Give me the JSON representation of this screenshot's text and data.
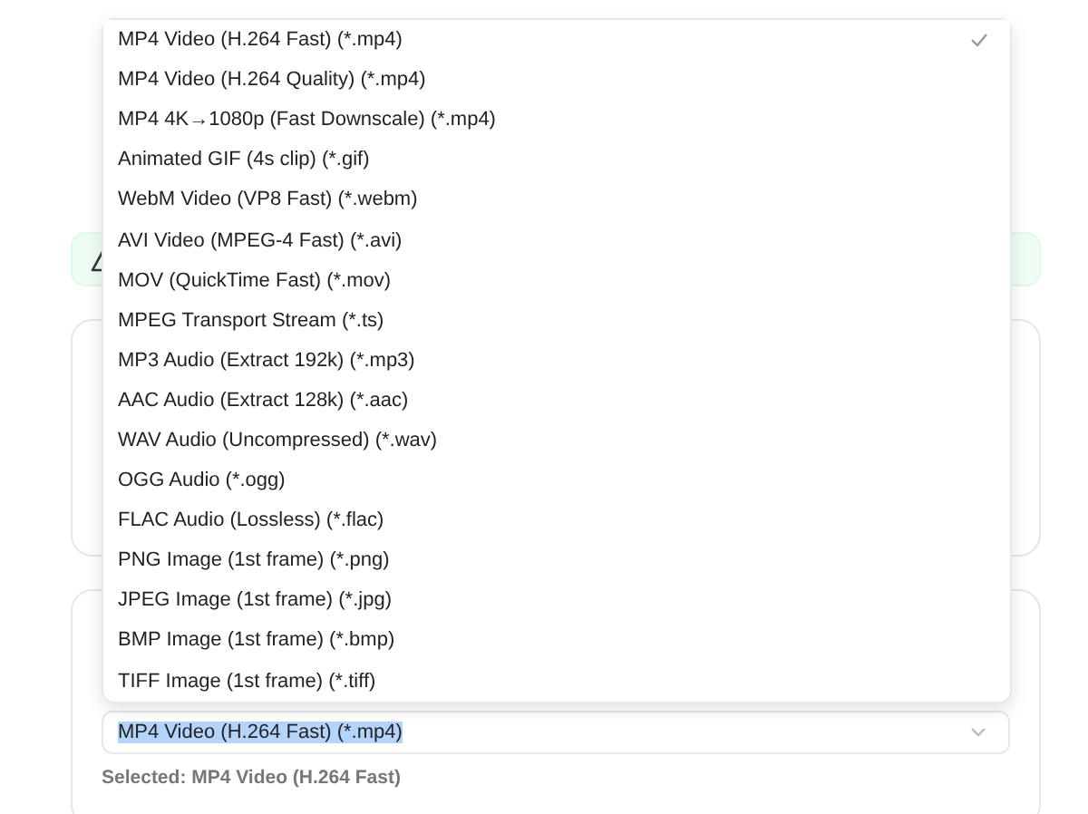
{
  "format_menu": {
    "options": [
      {
        "label": "MP4 Video (H.264 Fast) (*.mp4)",
        "selected": true
      },
      {
        "label": "MP4 Video (H.264 Quality) (*.mp4)",
        "selected": false
      },
      {
        "label": "MP4 4K→1080p (Fast Downscale) (*.mp4)",
        "selected": false
      },
      {
        "label": "Animated GIF (4s clip) (*.gif)",
        "selected": false
      },
      {
        "label": "WebM Video (VP8 Fast) (*.webm)",
        "selected": false
      },
      {
        "label": "AVI Video (MPEG-4 Fast) (*.avi)",
        "selected": false
      },
      {
        "label": "MOV (QuickTime Fast) (*.mov)",
        "selected": false
      },
      {
        "label": "MPEG Transport Stream (*.ts)",
        "selected": false
      },
      {
        "label": "MP3 Audio (Extract 192k) (*.mp3)",
        "selected": false
      },
      {
        "label": "AAC Audio (Extract 128k) (*.aac)",
        "selected": false
      },
      {
        "label": "WAV Audio (Uncompressed) (*.wav)",
        "selected": false
      },
      {
        "label": "OGG Audio (*.ogg)",
        "selected": false
      },
      {
        "label": "FLAC Audio (Lossless) (*.flac)",
        "selected": false
      },
      {
        "label": "PNG Image (1st frame) (*.png)",
        "selected": false
      },
      {
        "label": "JPEG Image (1st frame) (*.jpg)",
        "selected": false
      },
      {
        "label": "BMP Image (1st frame) (*.bmp)",
        "selected": false
      },
      {
        "label": "TIFF Image (1st frame) (*.tiff)",
        "selected": false
      }
    ]
  },
  "format_select": {
    "value": "MP4 Video (H.264 Fast) (*.mp4)",
    "text_highlighted": true
  },
  "selected_caption": "Selected: MP4 Video (H.264 Fast)"
}
